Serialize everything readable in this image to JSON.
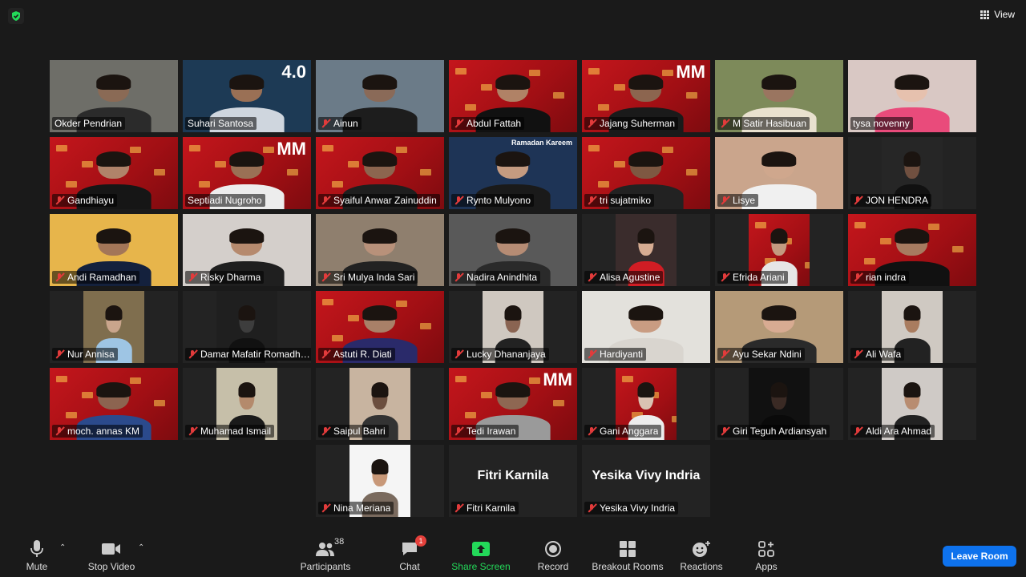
{
  "top": {
    "view_label": "View"
  },
  "participants": [
    {
      "name": "Okder Pendrian",
      "muted": false,
      "bg": "#6e6e68",
      "skin": "#8a6a55",
      "shirt": "#2b2b2b"
    },
    {
      "name": "Suhari Santosa",
      "muted": false,
      "bg": "#1d3a55",
      "skin": "#9a7055",
      "shirt": "#cfd6de",
      "active": true,
      "banner": "4.0"
    },
    {
      "name": "Ainun",
      "muted": true,
      "bg": "#6b7b88",
      "skin": "#8a6a58",
      "shirt": "#1d1d1d"
    },
    {
      "name": "Abdul Fattah",
      "muted": true,
      "bg": "red",
      "skin": "#b08266",
      "shirt": "#111"
    },
    {
      "name": "Jajang Suherman",
      "muted": true,
      "bg": "red",
      "skin": "#8c654f",
      "shirt": "#1a1a1a",
      "banner": "MM"
    },
    {
      "name": "M Satir Hasibuan",
      "muted": true,
      "bg": "#7d8a5a",
      "skin": "#9a7560",
      "shirt": "#e9e1cf"
    },
    {
      "name": "tysa novenny",
      "muted": false,
      "bg": "#d9c8c4",
      "skin": "#e6c1ae",
      "shirt": "#e94b7b"
    },
    {
      "name": "Gandhiayu",
      "muted": true,
      "bg": "red",
      "skin": "#b0836a",
      "shirt": "#161616"
    },
    {
      "name": "Septiadi Nugroho",
      "muted": false,
      "bg": "red",
      "skin": "#9a7055",
      "shirt": "#ededed",
      "banner": "MM"
    },
    {
      "name": "Syaiful Anwar Zainuddin",
      "muted": true,
      "bg": "red",
      "skin": "#8c654f",
      "shirt": "#1e1e1e"
    },
    {
      "name": "Rynto Mulyono",
      "muted": true,
      "bg": "#1e3456",
      "skin": "#c59b80",
      "shirt": "#1a1a1a",
      "banner": "Ramadan Kareem"
    },
    {
      "name": "tri sujatmiko",
      "muted": true,
      "bg": "red",
      "skin": "#7e5842",
      "shirt": "#222"
    },
    {
      "name": "Lisye",
      "muted": true,
      "bg": "#caa58c",
      "skin": "#cfa78d",
      "shirt": "#f0f0f0"
    },
    {
      "name": "JON HENDRA",
      "muted": true,
      "bg": "#262626",
      "skin": "#705040",
      "shirt": "#111",
      "narrow": true
    },
    {
      "name": "Andi Ramadhan",
      "muted": true,
      "bg": "#e7b54b",
      "skin": "#a37658",
      "shirt": "#14213d"
    },
    {
      "name": "Risky Dharma",
      "muted": true,
      "bg": "#d4cfcb",
      "skin": "#b68a6e",
      "shirt": "#1f1f1f"
    },
    {
      "name": "Sri Mulya Inda Sari",
      "muted": true,
      "bg": "#8f7f6e",
      "skin": "#b8917a",
      "shirt": "#222"
    },
    {
      "name": "Nadira Anindhita",
      "muted": true,
      "bg": "#595959",
      "skin": "#b68c74",
      "shirt": "#2a2a2a"
    },
    {
      "name": "Alisa Agustine",
      "muted": true,
      "bg": "#3a2c2c",
      "skin": "#d6ac92",
      "shirt": "#d01d24",
      "narrow": true
    },
    {
      "name": "Efrida Ariani",
      "muted": true,
      "bg": "red",
      "skin": "#c39a80",
      "shirt": "#e6e6e6",
      "narrow": true
    },
    {
      "name": "rian indra",
      "muted": true,
      "bg": "red",
      "skin": "#a77b60",
      "shirt": "#111"
    },
    {
      "name": "Nur Annisa",
      "muted": true,
      "bg": "#7f6e4e",
      "skin": "#c9a58c",
      "shirt": "#9ec5e4",
      "narrow": true
    },
    {
      "name": "Damar Mafatir Romadhon",
      "muted": true,
      "bg": "#1f1f1f",
      "skin": "#3d3d3d",
      "shirt": "#111",
      "narrow": true
    },
    {
      "name": "Astuti R. Diati",
      "muted": true,
      "bg": "red",
      "skin": "#a98068",
      "shirt": "#2a2a6a"
    },
    {
      "name": "Lucky Dhananjaya",
      "muted": true,
      "bg": "#cfc8c0",
      "skin": "#8a6452",
      "shirt": "#222",
      "narrow": true
    },
    {
      "name": "Hardiyanti",
      "muted": true,
      "bg": "#e3e1dc",
      "skin": "#c99c82",
      "shirt": "#d9d5cf"
    },
    {
      "name": "Ayu Sekar Ndini",
      "muted": true,
      "bg": "#b59a78",
      "skin": "#d8ab92",
      "shirt": "#2a2a2a"
    },
    {
      "name": "Ali Wafa",
      "muted": true,
      "bg": "#cfc9c2",
      "skin": "#a97c5f",
      "shirt": "#222",
      "narrow": true
    },
    {
      "name": "moch. annas KM",
      "muted": true,
      "bg": "red",
      "skin": "#8c6450",
      "shirt": "#2b4a8c"
    },
    {
      "name": "Muhamad Ismail",
      "muted": true,
      "bg": "#c6bfa9",
      "skin": "#b48a6c",
      "shirt": "#1a1a1a",
      "narrow": true
    },
    {
      "name": "Saipul Bahri",
      "muted": true,
      "bg": "#c8b4a0",
      "skin": "#6b4e3e",
      "shirt": "#333",
      "narrow": true
    },
    {
      "name": "Tedi Irawan",
      "muted": true,
      "bg": "red",
      "skin": "#8e6752",
      "shirt": "#9a9a9a",
      "banner": "MM"
    },
    {
      "name": "Gani Anggara",
      "muted": true,
      "bg": "red",
      "skin": "#d9c2b2",
      "shirt": "#ececec",
      "narrow": true
    },
    {
      "name": "Giri Teguh Ardiansyah",
      "muted": true,
      "bg": "#111111",
      "skin": "#3a2a24",
      "shirt": "#0a0a0a",
      "narrow": true
    },
    {
      "name": "Aldi Ara Ahmad",
      "muted": true,
      "bg": "#cfcac6",
      "skin": "#b88c70",
      "shirt": "#222",
      "narrow": true
    },
    {
      "name": "Nina Meriana",
      "muted": true,
      "bg": "#f5f5f5",
      "skin": "#c89878",
      "shirt": "#7a6a5e",
      "narrow": true
    },
    {
      "name": "Fitri Karnila",
      "muted": true,
      "bg": "#232323",
      "video_off": true
    },
    {
      "name": "Yesika Vivy Indria",
      "muted": true,
      "bg": "#232323",
      "video_off": true
    }
  ],
  "toolbar": {
    "mute_label": "Mute",
    "video_label": "Stop Video",
    "participants_label": "Participants",
    "participants_count": "38",
    "chat_label": "Chat",
    "chat_badge": "1",
    "share_label": "Share Screen",
    "record_label": "Record",
    "breakout_label": "Breakout Rooms",
    "reactions_label": "Reactions",
    "apps_label": "Apps",
    "leave_label": "Leave Room"
  },
  "colors": {
    "active_speaker": "#c7dd3b",
    "leave": "#0e72ed",
    "share": "#23d959",
    "muted_mic": "#e23b3b"
  }
}
